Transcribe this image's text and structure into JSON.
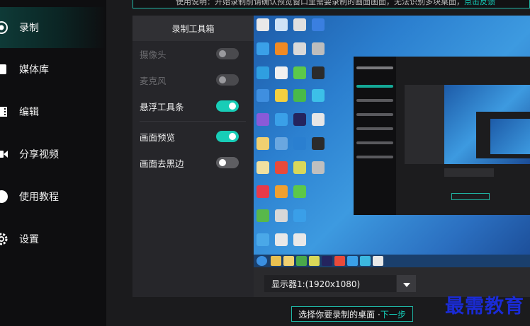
{
  "sidebar": {
    "items": [
      {
        "label": "录制",
        "icon": "record-icon",
        "active": true
      },
      {
        "label": "媒体库",
        "icon": "media-library-icon",
        "active": false
      },
      {
        "label": "编辑",
        "icon": "film-icon",
        "active": false
      },
      {
        "label": "分享视频",
        "icon": "video-camera-icon",
        "active": false
      },
      {
        "label": "使用教程",
        "icon": "help-icon",
        "active": false
      },
      {
        "label": "设置",
        "icon": "gear-icon",
        "active": false
      }
    ]
  },
  "top_notice": {
    "text": "使用说明：开始录制前请确认预览窗口里需要录制的画面画面，无法识别多块桌面，",
    "link": "点击反馈"
  },
  "toolbox": {
    "title": "录制工具箱",
    "items": [
      {
        "label": "摄像头",
        "state": "off",
        "disabled": true
      },
      {
        "label": "麦克风",
        "state": "off",
        "disabled": true
      },
      {
        "label": "悬浮工具条",
        "state": "on",
        "disabled": false
      },
      {
        "label": "画面预览",
        "state": "on",
        "disabled": false
      },
      {
        "label": "画面去黑边",
        "state": "off",
        "disabled": false
      }
    ]
  },
  "monitor_select": {
    "value": "显示器1:(1920x1080)"
  },
  "next_step": {
    "prefix": "选择你要录制的桌面 · ",
    "action": "下一步"
  },
  "watermark": {
    "text": "最需教育"
  },
  "colors": {
    "accent": "#18cdb7",
    "sidebar_bg": "#0e0e10",
    "panel_bg": "#26262a",
    "watermark": "#1a2bd6"
  }
}
